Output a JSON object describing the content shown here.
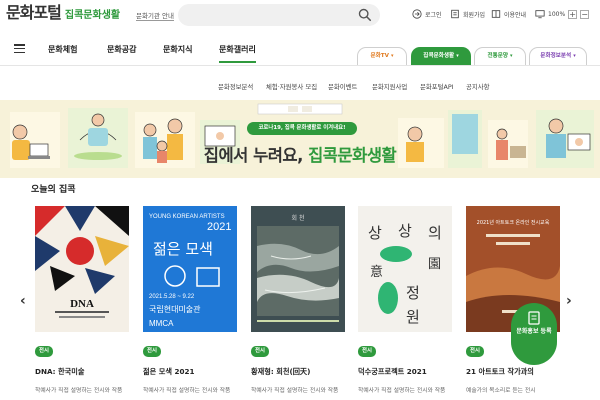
{
  "header": {
    "logo_main": "문화포털",
    "logo_sub": "집콕문화생활",
    "all_sites_link": "문화기관 안내",
    "search_placeholder": "",
    "utils": {
      "login": "로그인",
      "join": "회원가입",
      "guide": "이용안내",
      "zoom": "100%"
    }
  },
  "main_nav": {
    "items": [
      "문화체험",
      "문화공감",
      "문화지식",
      "문화갤러리"
    ],
    "pills": [
      {
        "label": "문화TV",
        "color": "#e07a1f"
      },
      {
        "label": "집콕문화생활",
        "color": "#ffffff",
        "bg": "#2f9a3d"
      },
      {
        "label": "전통문양",
        "color": "#2f9a3d"
      },
      {
        "label": "문화정보분석",
        "color": "#7b3fb0"
      }
    ]
  },
  "sub_nav": {
    "items": [
      "문화정보분석",
      "체험·자원봉사 모집",
      "문화이벤트",
      "문화지원사업",
      "문화포털API",
      "공지사항"
    ]
  },
  "banner": {
    "badge": "코로나19, 집콕 문화생활로 이겨내요!",
    "title_prefix": "집에서 누려요, ",
    "title_highlight": "집콕문화생활"
  },
  "section": {
    "title": "오늘의 집콕",
    "cards": [
      {
        "tag": "전시",
        "title": "DNA: 한국미술",
        "desc": "학예사가 직접 설명하는 전시와 작품"
      },
      {
        "tag": "전시",
        "title": "젊은 모색 2021",
        "desc": "학예사가 직접 설명하는 전시와 작품"
      },
      {
        "tag": "전시",
        "title": "황재형: 회천(回天)",
        "desc": "학예사가 직접 설명하는 전시와 작품"
      },
      {
        "tag": "전시",
        "title": "덕수궁프로젝트 2021",
        "desc": "학예사가 직접 설명하는 전시와 작품"
      },
      {
        "tag": "전시",
        "title": "21 아트토크 작가과의",
        "desc": "예술가의 목소리로 듣는 전시"
      }
    ],
    "poster_texts": {
      "p1": "DNA",
      "p2_top": "YOUNG KOREAN ARTISTS",
      "p2_year": "2021",
      "p2_title": "젊은 모색",
      "p2_date": "2021.5.28 ~ 9.22",
      "p2_museum": "국립현대미술관",
      "p3_top": "회 천",
      "p4_chars": [
        "상",
        "상",
        "의",
        "園",
        "意",
        "정",
        "원"
      ],
      "p5_text": "2021년 아트토크 온라인 전시교육"
    }
  },
  "floating": {
    "label": "문화홍보 등록"
  },
  "colors": {
    "brand_green": "#2f9a3d",
    "banner_bg": "#f7f2d9"
  }
}
